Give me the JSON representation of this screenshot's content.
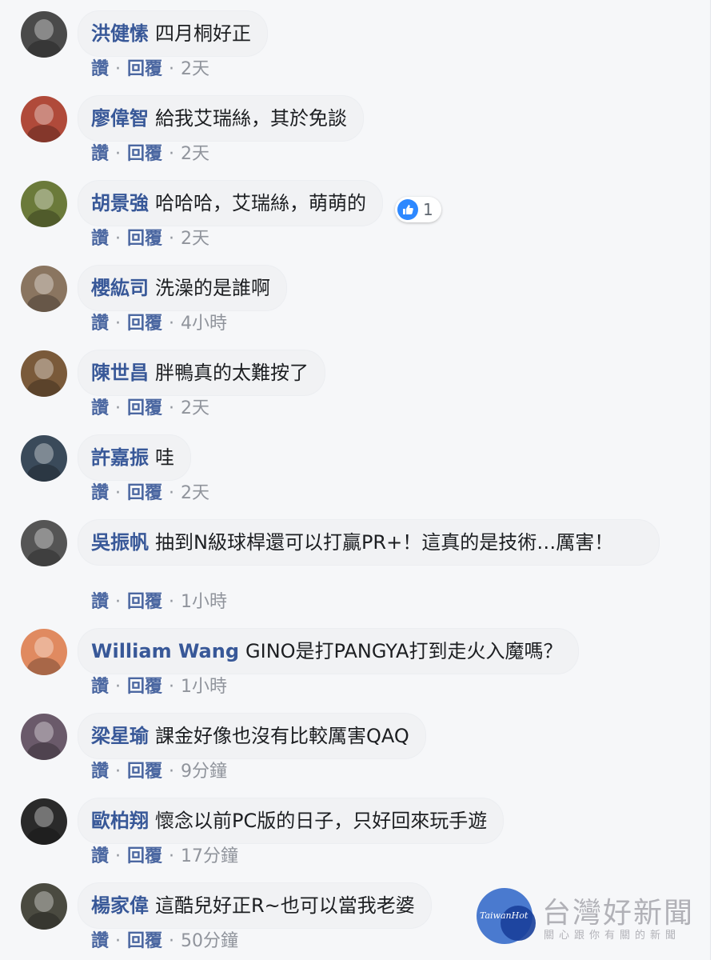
{
  "actions": {
    "like": "讚",
    "reply": "回覆",
    "separator": "·"
  },
  "comments": [
    {
      "name": "洪健愫",
      "text": "四月桐好正",
      "time": "2天",
      "avatar_color": "#4a4a4a"
    },
    {
      "name": "廖偉智",
      "text": "給我艾瑞絲，其於免談",
      "time": "2天",
      "avatar_color": "#b04a3a"
    },
    {
      "name": "胡景強",
      "text": "哈哈哈，艾瑞絲，萌萌的",
      "time": "2天",
      "avatar_color": "#6b7a3a",
      "reaction_count": "1"
    },
    {
      "name": "櫻紘司",
      "text": "洗澡的是誰啊",
      "time": "4小時",
      "avatar_color": "#8a7560"
    },
    {
      "name": "陳世昌",
      "text": "胖鴨真的太難按了",
      "time": "2天",
      "avatar_color": "#7a5a3a"
    },
    {
      "name": "許嘉振",
      "text": "哇",
      "time": "2天",
      "avatar_color": "#3a4a5a"
    },
    {
      "name": "吳振帆",
      "text": "抽到N級球桿還可以打贏PR+！這真的是技術…厲害！",
      "time": "1小時",
      "avatar_color": "#555555"
    },
    {
      "name": "William Wang",
      "text": "GINO是打PANGYA打到走火入魔嗎？",
      "time": "1小時",
      "avatar_color": "#e08a60"
    },
    {
      "name": "梁星瑜",
      "text": "課金好像也沒有比較厲害QAQ",
      "time": "9分鐘",
      "avatar_color": "#6a5a6a"
    },
    {
      "name": "歐柏翔",
      "text": "懷念以前PC版的日子，只好回來玩手遊",
      "time": "17分鐘",
      "avatar_color": "#2a2a2a"
    },
    {
      "name": "楊家偉",
      "text": "這酷兒好正R~也可以當我老婆",
      "time": "50分鐘",
      "avatar_color": "#4a4a40"
    }
  ],
  "watermark": {
    "logo_text": "TaiwanHot",
    "title": "台灣好新聞",
    "subtitle": "關心跟你有關的新聞"
  }
}
